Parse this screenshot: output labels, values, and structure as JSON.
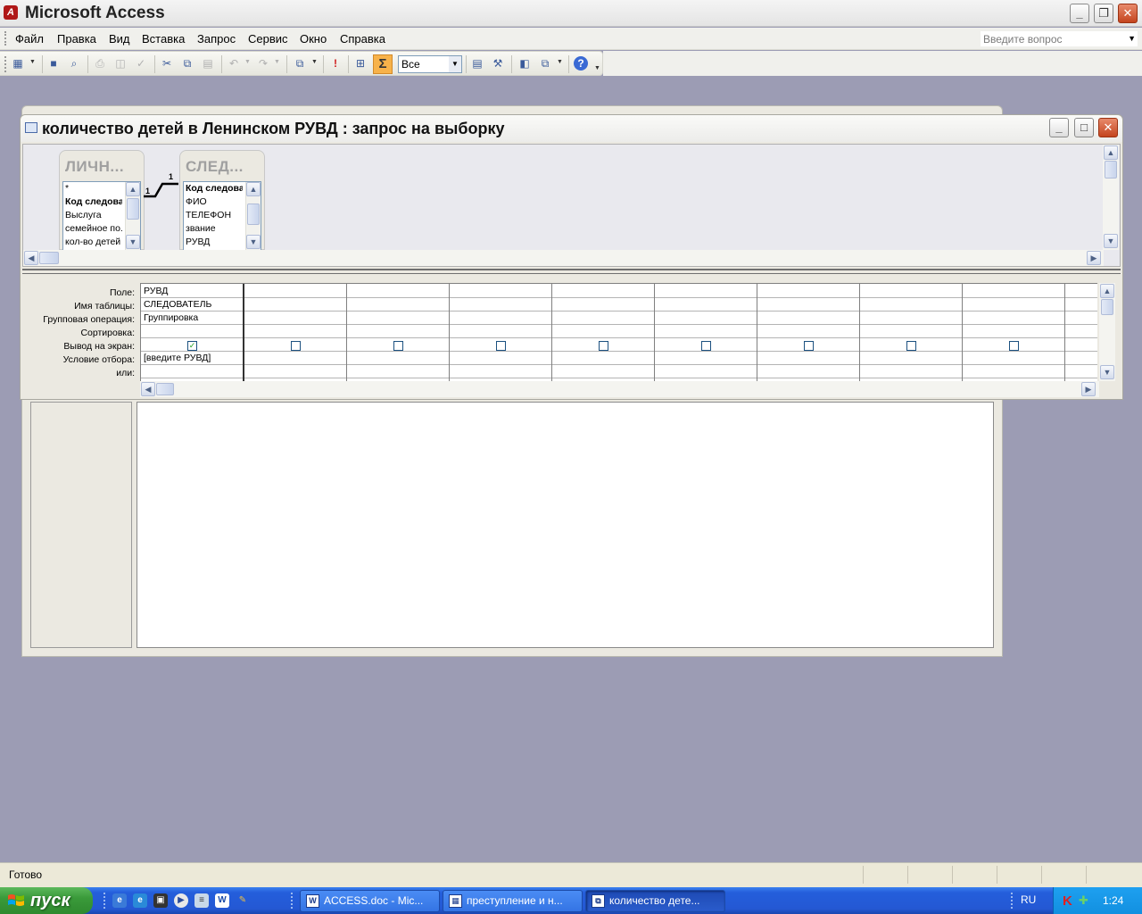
{
  "app": {
    "title": "Microsoft Access"
  },
  "menu": [
    "Файл",
    "Правка",
    "Вид",
    "Вставка",
    "Запрос",
    "Сервис",
    "Окно",
    "Справка"
  ],
  "ask": {
    "placeholder": "Введите вопрос"
  },
  "toolbar": {
    "sigma": "Σ",
    "top_values": "Все"
  },
  "query_window": {
    "title": "количество детей в Ленинском РУВД : запрос на выборку"
  },
  "tables": [
    {
      "name": "ЛИЧН...",
      "fields": [
        "*",
        "Код следова",
        "Выслуга",
        "семейное по...",
        "кол-во детей"
      ],
      "key_field": 1
    },
    {
      "name": "СЛЕД...",
      "fields": [
        "Код следова",
        "ФИО",
        "ТЕЛЕФОН",
        "звание",
        "РУВД"
      ],
      "key_field": 0
    }
  ],
  "relationship": {
    "left_end": "1",
    "right_end": "1"
  },
  "grid": {
    "row_labels": [
      "Поле:",
      "Имя таблицы:",
      "Групповая операция:",
      "Сортировка:",
      "Вывод на экран:",
      "Условие отбора:",
      "или:"
    ],
    "columns": [
      {
        "field": "РУВД",
        "table": "СЛЕДОВАТЕЛЬ",
        "group": "Группировка",
        "sort": "",
        "show": true,
        "criteria": "[введите РУВД]",
        "or": ""
      },
      {
        "field": "",
        "table": "",
        "group": "",
        "sort": "",
        "show": false,
        "criteria": "",
        "or": ""
      },
      {
        "field": "",
        "table": "",
        "group": "",
        "sort": "",
        "show": false,
        "criteria": "",
        "or": ""
      },
      {
        "field": "",
        "table": "",
        "group": "",
        "sort": "",
        "show": false,
        "criteria": "",
        "or": ""
      },
      {
        "field": "",
        "table": "",
        "group": "",
        "sort": "",
        "show": false,
        "criteria": "",
        "or": ""
      },
      {
        "field": "",
        "table": "",
        "group": "",
        "sort": "",
        "show": false,
        "criteria": "",
        "or": ""
      },
      {
        "field": "",
        "table": "",
        "group": "",
        "sort": "",
        "show": false,
        "criteria": "",
        "or": ""
      },
      {
        "field": "",
        "table": "",
        "group": "",
        "sort": "",
        "show": false,
        "criteria": "",
        "or": ""
      },
      {
        "field": "",
        "table": "",
        "group": "",
        "sort": "",
        "show": false,
        "criteria": "",
        "or": ""
      },
      {
        "field": "",
        "table": "",
        "group": "",
        "sort": "",
        "show": false,
        "criteria": "",
        "or": ""
      }
    ]
  },
  "status": {
    "text": "Готово"
  },
  "taskbar": {
    "start": "пуск",
    "tasks": [
      "ACCESS.doc - Mic...",
      "преступление и н...",
      "количество дете..."
    ],
    "lang": "RU",
    "clock": "1:24"
  }
}
